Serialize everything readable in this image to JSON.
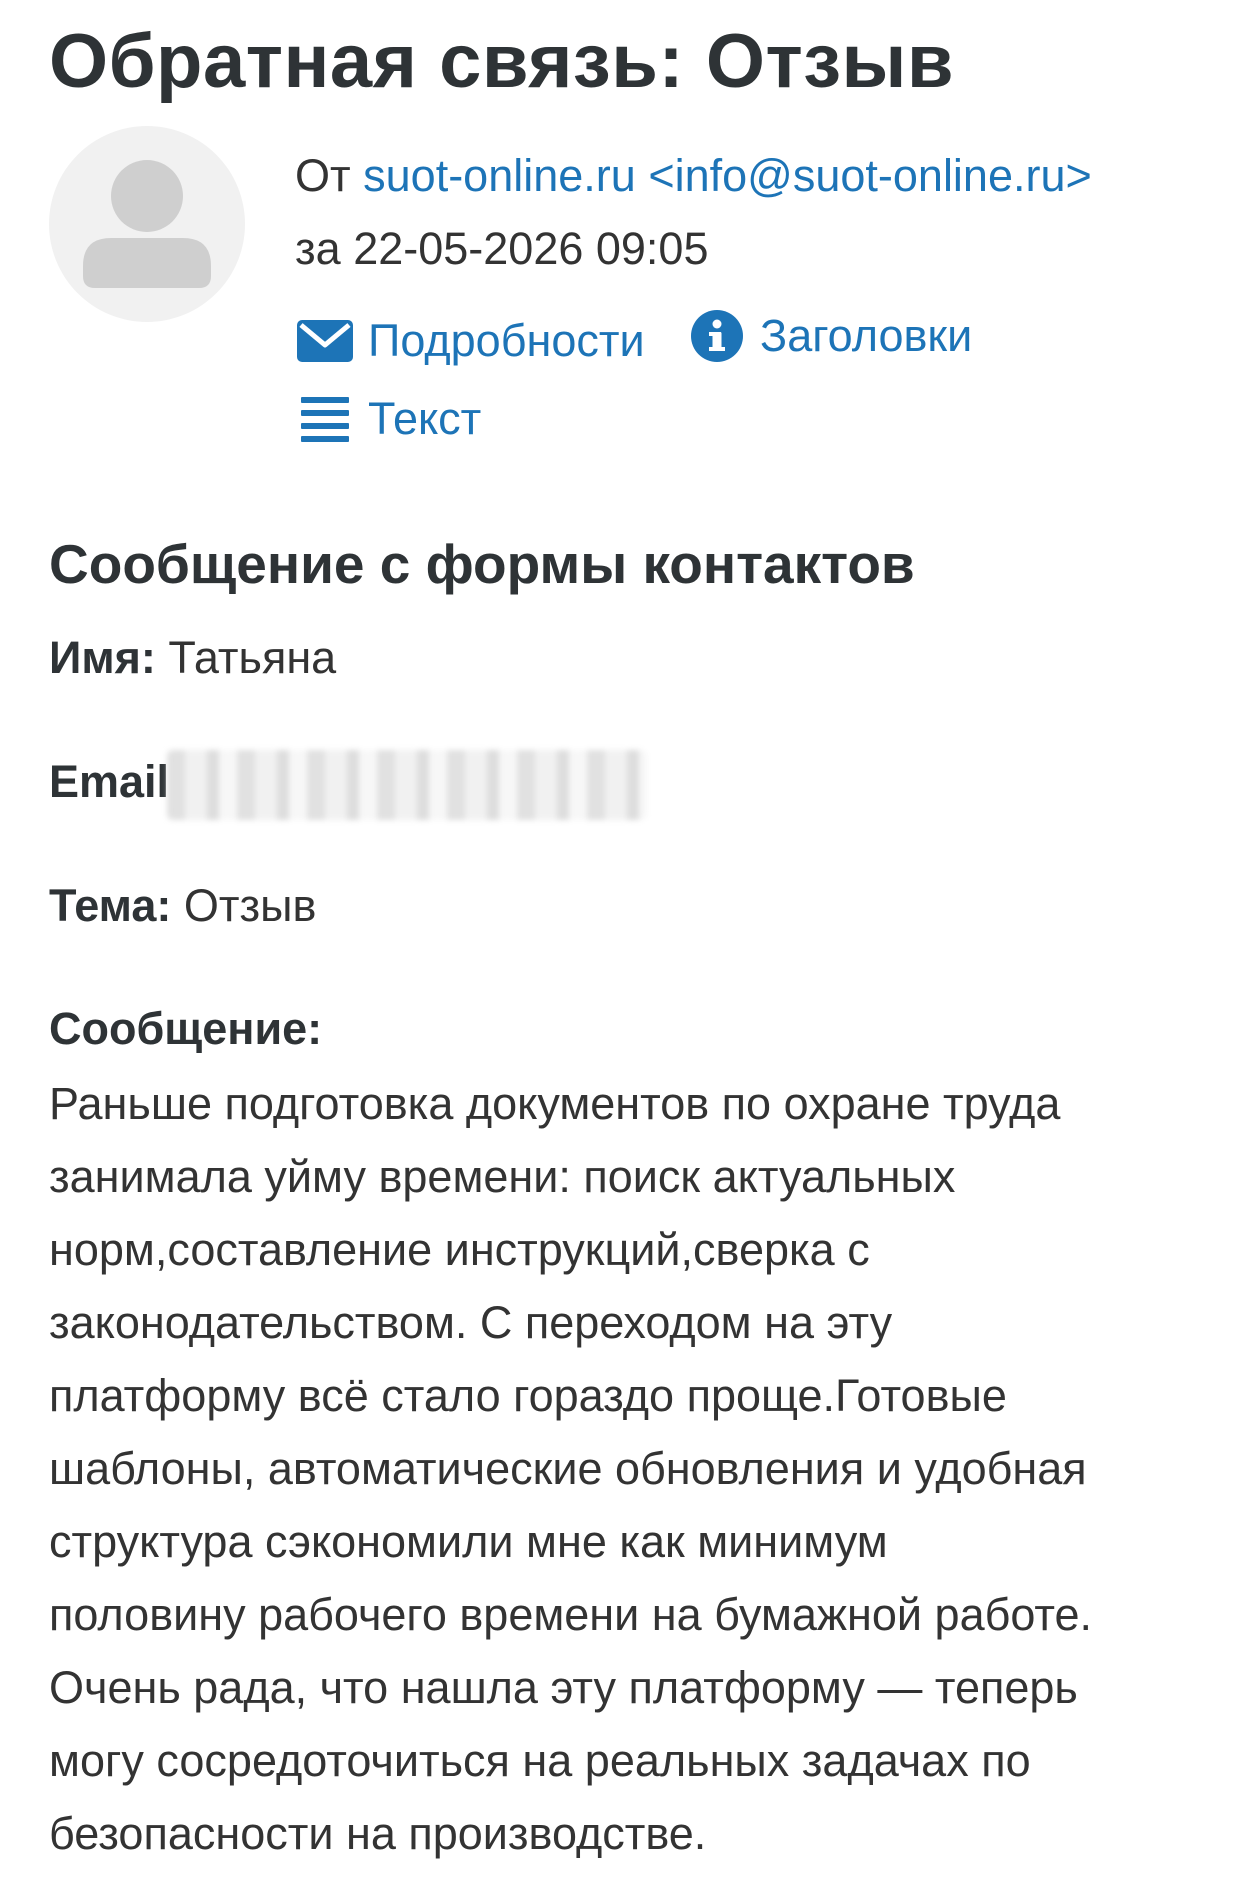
{
  "header": {
    "title": "Обратная связь: Отзыв"
  },
  "sender": {
    "from_prefix": "От",
    "from_name": "suot-online.ru",
    "from_email": "<info@suot-online.ru>",
    "date_prefix": "за",
    "date": "22-05-2026 09:05"
  },
  "actions": {
    "details": "Подробности",
    "headers": "Заголовки",
    "text": "Текст"
  },
  "content": {
    "section_title": "Сообщение с формы контактов",
    "name_label": "Имя:",
    "name_value": "Татьяна",
    "email_label": "Email",
    "subject_label": "Тема:",
    "subject_value": "Отзыв",
    "message_label": "Сообщение:",
    "message_lines": [
      "Раньше подготовка документов по охране труда",
      "занимала уйму времени: поиск актуальных",
      "норм,составление инструкций,сверка с",
      "законодательством. С переходом на эту",
      "платформу всё стало гораздо проще.Готовые",
      "шаблоны, автоматические обновления и удобная",
      "структура сэкономили мне как минимум",
      "половину рабочего времени на бумажной работе.",
      "Очень рада, что нашла эту платформу — теперь",
      "могу сосредоточиться на реальных задачах по",
      "безопасности на производстве."
    ]
  },
  "colors": {
    "link": "#1d74b7",
    "text": "#333333",
    "heading": "#2e3336",
    "avatar_bg": "#f1f1f1",
    "avatar_fg": "#cfcfcf"
  }
}
